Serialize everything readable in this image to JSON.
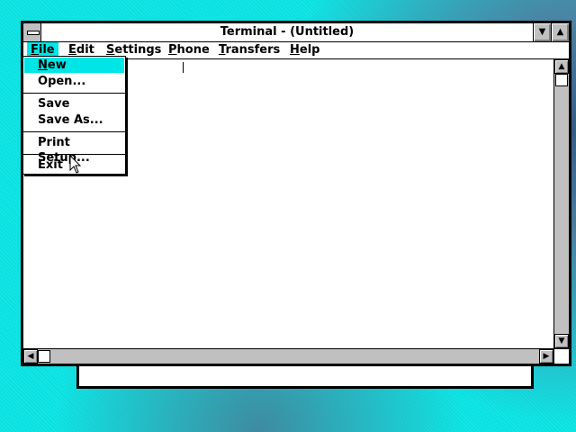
{
  "window": {
    "title": "Terminal - (Untitled)",
    "minimize_glyph": "▼",
    "maximize_glyph": "▲"
  },
  "menubar": {
    "items": [
      {
        "label_u": "F",
        "label_rest": "ile",
        "active": true
      },
      {
        "label_u": "E",
        "label_rest": "dit"
      },
      {
        "label_u": "S",
        "label_rest": "ettings"
      },
      {
        "label_u": "P",
        "label_rest": "hone"
      },
      {
        "label_u": "T",
        "label_rest": "ransfers"
      },
      {
        "label_u": "H",
        "label_rest": "elp"
      }
    ]
  },
  "file_menu": {
    "new": {
      "u": "N",
      "rest": "ew"
    },
    "open": {
      "u": "O",
      "rest": "pen..."
    },
    "save": {
      "u": "S",
      "rest": "ave"
    },
    "save_as": {
      "pre": "Save ",
      "u": "A",
      "rest": "s..."
    },
    "print_setup": {
      "u": "P",
      "rest": "rint Setup..."
    },
    "exit": {
      "pre": "E",
      "u": "x",
      "rest": "it"
    }
  },
  "scrollbars": {
    "up_glyph": "▲",
    "down_glyph": "▼",
    "left_glyph": "◀",
    "right_glyph": "▶"
  },
  "colors": {
    "desktop": "#10e6e6",
    "highlight": "#00e6e6",
    "chrome": "#c0c0c0"
  }
}
